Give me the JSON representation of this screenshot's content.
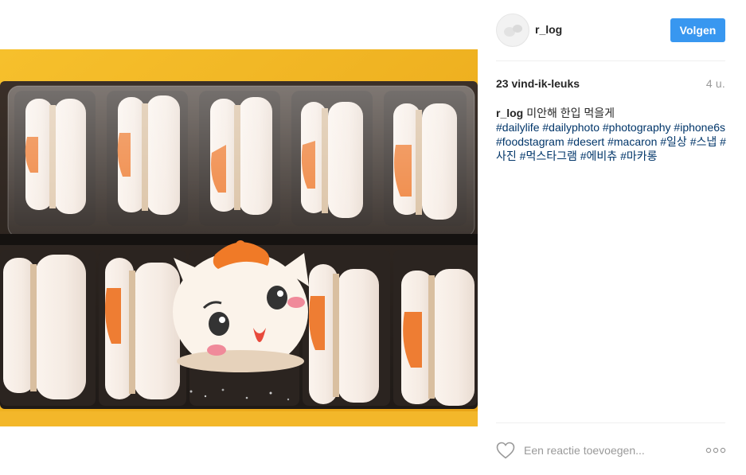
{
  "post": {
    "username": "r_log",
    "follow_label": "Volgen",
    "likes": "23 vind-ik-leuks",
    "time": "4 u.",
    "caption_text": "미안해 한입 먹을게",
    "hashtags": [
      "#dailylife",
      "#dailyphoto",
      "#photography",
      "#iphone6s",
      "#foodstagram",
      "#desert",
      "#macaron",
      "#일상",
      "#스냅",
      "#사진",
      "#먹스타그램",
      "#에비츄",
      "#마카롱"
    ],
    "comment_placeholder": "Een reactie toevoegen...",
    "photo_subject": "box of cat-face macarons"
  },
  "icons": {
    "like": "heart-outline-icon",
    "more": "more-options-icon"
  },
  "colors": {
    "accent": "#3897f0",
    "hashtag": "#003569",
    "muted": "#999999",
    "text": "#262626",
    "box_yellow": "#f2b41e"
  }
}
